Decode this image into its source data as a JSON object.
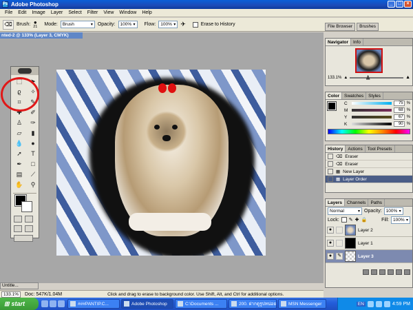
{
  "window": {
    "title": "Adobe Photoshop"
  },
  "menu": [
    "File",
    "Edit",
    "Image",
    "Layer",
    "Select",
    "Filter",
    "View",
    "Window",
    "Help"
  ],
  "options": {
    "brush_label": "Brush:",
    "brush_size": "21",
    "mode_label": "Mode:",
    "mode_value": "Brush",
    "opacity_label": "Opacity:",
    "opacity_value": "100%",
    "flow_label": "Flow:",
    "flow_value": "100%",
    "erase_history": "Erase to History"
  },
  "palette_well": [
    "File Browser",
    "Brushes"
  ],
  "document": {
    "title": "nted-2 @ 133% (Layer 3, CMYK)",
    "zoom": "133.1%",
    "doc_size": "Doc: 547K/1.04M",
    "status_hint": "Click and drag to erase to background color.  Use Shift, Alt, and Ctrl for additional options.",
    "minimized_title": "Untitle..."
  },
  "navigator": {
    "tabs": [
      "Navigator",
      "Info"
    ],
    "zoom": "133.1%"
  },
  "color": {
    "tabs": [
      "Color",
      "Swatches",
      "Styles"
    ],
    "channels": [
      {
        "name": "C",
        "value": "75",
        "color": "#00aeef"
      },
      {
        "name": "M",
        "value": "68",
        "color": "#ec008c"
      },
      {
        "name": "Y",
        "value": "67",
        "color": "#fff200"
      },
      {
        "name": "K",
        "value": "90",
        "color": "#000000"
      }
    ],
    "pct": "%"
  },
  "history": {
    "tabs": [
      "History",
      "Actions",
      "Tool Presets"
    ],
    "items": [
      "Eraser",
      "Eraser",
      "New Layer",
      "Layer Order"
    ]
  },
  "layers": {
    "tabs": [
      "Layers",
      "Channels",
      "Paths"
    ],
    "blend": "Normal",
    "opacity_label": "Opacity:",
    "opacity_value": "100%",
    "lock_label": "Lock:",
    "fill_label": "Fill:",
    "fill_value": "100%",
    "items": [
      "Layer 2",
      "Layer 1",
      "Layer 3"
    ]
  },
  "taskbar": {
    "start": "start",
    "buttons": [
      "###PANTIP.C...",
      "Adobe Photoshop",
      "C:\\Documents ...",
      "200. ฝากดูรูปหน่อย",
      "MSN Messenger"
    ],
    "lang": "EN",
    "time": "4:59 PM"
  }
}
